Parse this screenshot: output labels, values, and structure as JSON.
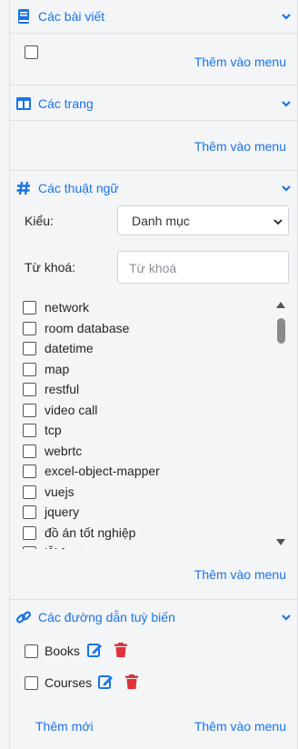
{
  "sections": {
    "posts": {
      "title": "Các bài viết",
      "add_label": "Thêm vào menu"
    },
    "pages": {
      "title": "Các trang",
      "add_label": "Thêm vào menu"
    },
    "terms": {
      "title": "Các thuật ngữ",
      "type_label": "Kiểu:",
      "type_value": "Danh mục",
      "keyword_label": "Từ khoá:",
      "keyword_placeholder": "Từ khoá",
      "items": [
        "network",
        "room database",
        "datetime",
        "map",
        "restful",
        "video call",
        "tcp",
        "webrtc",
        "excel-object-mapper",
        "vuejs",
        "jquery",
        "đồ án tốt nghiệp",
        "lỗi font"
      ],
      "add_label": "Thêm vào menu"
    },
    "custom_links": {
      "title": "Các đường dẫn tuỳ biến",
      "items": [
        "Books",
        "Courses"
      ],
      "new_label": "Thêm mới",
      "add_label": "Thêm vào menu"
    }
  },
  "colors": {
    "accent": "#1a73e8",
    "danger": "#e0313c",
    "background": "#f4f5f6"
  }
}
